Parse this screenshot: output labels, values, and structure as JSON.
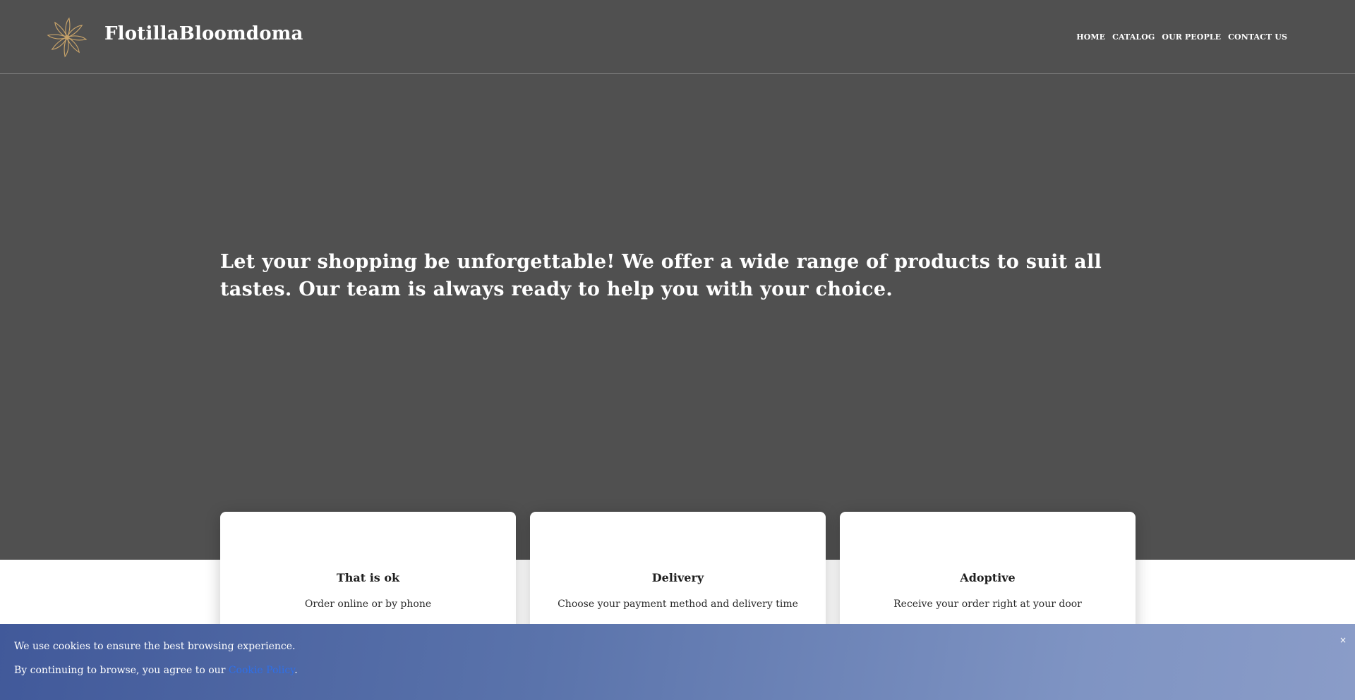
{
  "header": {
    "brand": "FlotillaBloomdoma",
    "logo_icon": "flower-logo-icon",
    "logo_color": "#c9a46a",
    "nav": [
      {
        "label": "HOME"
      },
      {
        "label": "CATALOG"
      },
      {
        "label": "OUR PEOPLE"
      },
      {
        "label": "CONTACT US"
      }
    ]
  },
  "hero": {
    "text": "Let your shopping be unforgettable! We offer a wide range of products to suit all tastes. Our team is always ready to help you with your choice.",
    "background": "#505050"
  },
  "cards": [
    {
      "title": "That is ok",
      "desc": "Order online or by phone"
    },
    {
      "title": "Delivery",
      "desc": "Choose your payment method and delivery time"
    },
    {
      "title": "Adoptive",
      "desc": "Receive your order right at your door"
    }
  ],
  "cookie": {
    "line1": "We use cookies to ensure the best browsing experience.",
    "line2_prefix": "By continuing to browse, you agree to our ",
    "link_label": "Cookie Policy",
    "line2_suffix": ".",
    "close_label": "×"
  }
}
